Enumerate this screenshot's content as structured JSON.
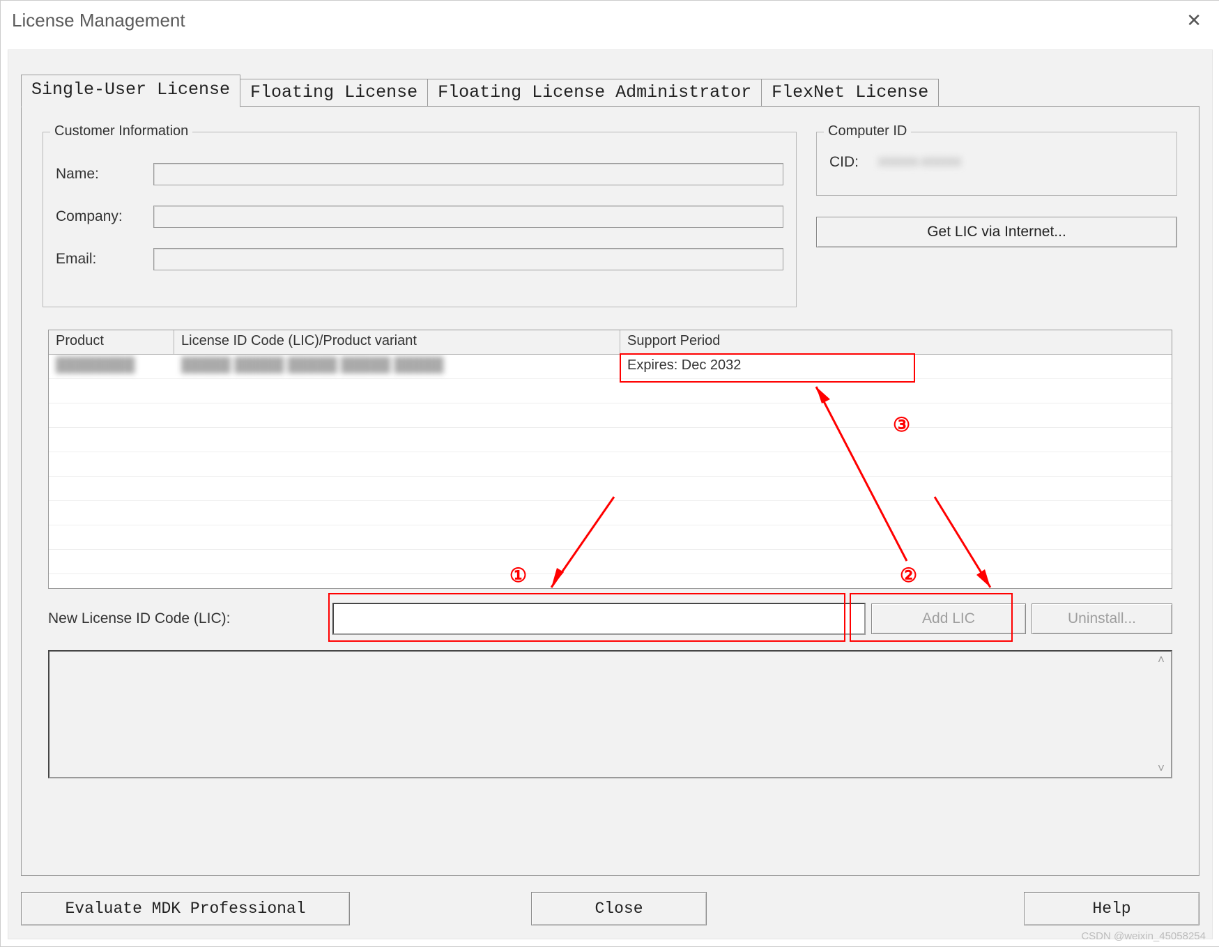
{
  "window": {
    "title": "License Management",
    "close_glyph": "✕"
  },
  "tabs": {
    "t0": "Single-User License",
    "t1": "Floating License",
    "t2": "Floating License Administrator",
    "t3": "FlexNet License"
  },
  "customer": {
    "legend": "Customer Information",
    "name_label": "Name:",
    "company_label": "Company:",
    "email_label": "Email:",
    "name": "",
    "company": "",
    "email": ""
  },
  "computer_id": {
    "legend": "Computer ID",
    "cid_label": "CID:",
    "cid_value": "XXXXX-XXXXX"
  },
  "buttons": {
    "get_lic": "Get LIC via Internet...",
    "add_lic": "Add LIC",
    "uninstall": "Uninstall...",
    "evaluate": "Evaluate MDK Professional",
    "close": "Close",
    "help": "Help"
  },
  "table": {
    "h_product": "Product",
    "h_lic": "License ID Code (LIC)/Product variant",
    "h_support": "Support Period",
    "rows": [
      {
        "product": "████████",
        "lic": "█████ █████ █████ █████ █████",
        "support": "Expires: Dec 2032"
      }
    ]
  },
  "new_lic": {
    "label": "New License ID Code (LIC):",
    "value": ""
  },
  "annotations": {
    "n1": "①",
    "n2": "②",
    "n3": "③"
  },
  "watermark": "CSDN @weixin_45058254"
}
